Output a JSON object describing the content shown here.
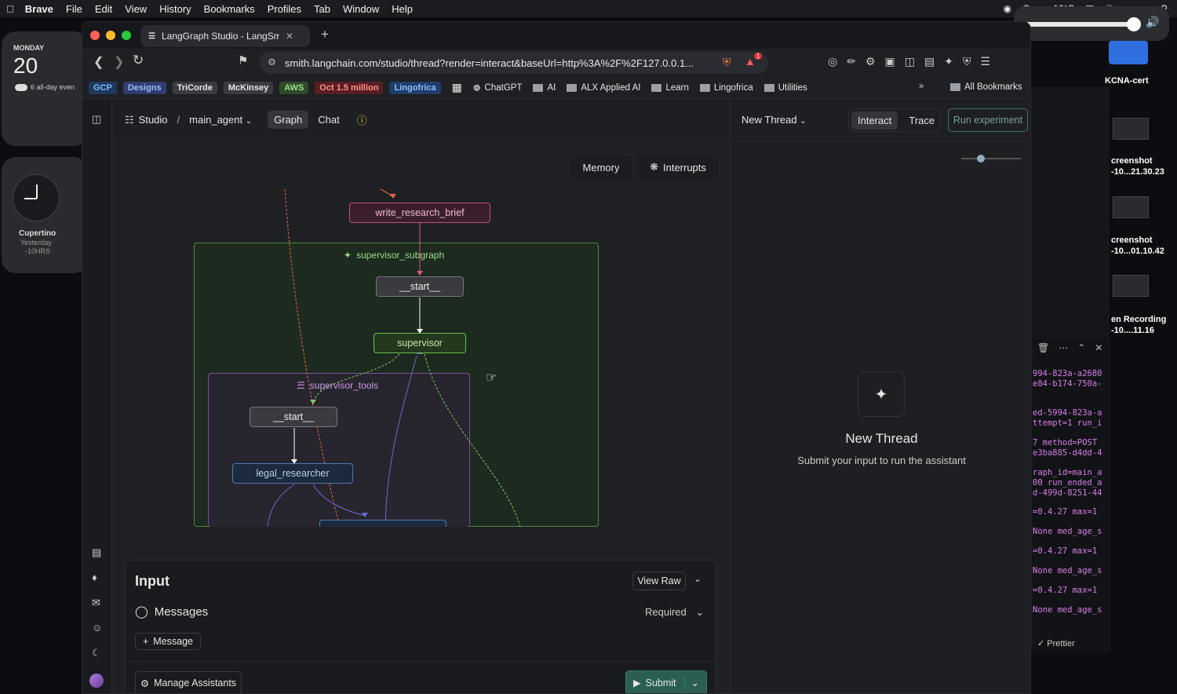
{
  "menubar": {
    "app": "Brave",
    "items": [
      "File",
      "Edit",
      "View",
      "History",
      "Bookmarks",
      "Profiles",
      "Tab",
      "Window",
      "Help"
    ],
    "temperature": "16°C"
  },
  "calendar_widget": {
    "day": "MONDAY",
    "date": "20",
    "event": "6 all-day even"
  },
  "clock_widget": {
    "city": "Cupertino",
    "when": "Yesterday",
    "offset": "-10HRS"
  },
  "browser": {
    "tab_title": "LangGraph Studio - LangSmith",
    "url": "smith.langchain.com/studio/thread?render=interact&baseUrl=http%3A%2F%2F127.0.0.1...",
    "shield_count": "1"
  },
  "bookmarks": {
    "tags": [
      {
        "label": "GCP",
        "bg": "#1d3a5c",
        "fg": "#7fb6ff"
      },
      {
        "label": "Designs",
        "bg": "#2f3e6e",
        "fg": "#9fb8ff"
      },
      {
        "label": "TriCorde",
        "bg": "#3a3b40",
        "fg": "#e8e8e8"
      },
      {
        "label": "McKinsey",
        "bg": "#3a3b40",
        "fg": "#e8e8e8"
      },
      {
        "label": "AWS",
        "bg": "#2d4a2a",
        "fg": "#9fe090"
      },
      {
        "label": "Oct 1.5 million",
        "bg": "#5a1e22",
        "fg": "#ff8f8f"
      },
      {
        "label": "Lingofrica",
        "bg": "#1f3e6a",
        "fg": "#8fbfff"
      }
    ],
    "items": [
      "ChatGPT",
      "AI",
      "ALX Applied AI",
      "Learn",
      "Lingofrica",
      "Utilities"
    ],
    "all": "All Bookmarks"
  },
  "studio": {
    "breadcrumb_root": "Studio",
    "sep": "/",
    "graph_name": "main_agent",
    "tabs": [
      "Graph",
      "Chat"
    ],
    "right_thread": "New Thread",
    "right_tabs": [
      "Interact",
      "Trace"
    ],
    "run_experiment": "Run experiment",
    "canvas_buttons": {
      "memory": "Memory",
      "interrupts": "Interrupts"
    }
  },
  "graph": {
    "nodes": {
      "write_research_brief": "write_research_brief",
      "supervisor_subgraph": "supervisor_subgraph",
      "start1": "__start__",
      "supervisor": "supervisor",
      "supervisor_tools": "supervisor_tools",
      "start2": "__start__",
      "legal_researcher": "legal_researcher"
    }
  },
  "input_panel": {
    "title": "Input",
    "view_raw": "View Raw",
    "messages": "Messages",
    "required": "Required",
    "add_message": "Message",
    "manage": "Manage Assistants",
    "submit": "Submit"
  },
  "empty_state": {
    "title": "New Thread",
    "subtitle": "Submit your input to run the assistant"
  },
  "desktop_files": [
    {
      "name": "KCNA-cert"
    },
    {
      "name": "creenshot",
      "sub": "-10...21.30.23"
    },
    {
      "name": "creenshot",
      "sub": "-10...01.10.42"
    },
    {
      "name": "en Recording",
      "sub": "-10....11.16"
    }
  ],
  "terminal_lines": [
    {
      "text": "994-823a-a2680",
      "color": "#d77ee8"
    },
    {
      "text": "e84-b174-750a-",
      "color": "#d77ee8"
    },
    {
      "text": "ed-5994-823a-a",
      "color": "#d77ee8"
    },
    {
      "text": "ttempt=1 run_i",
      "color": "#d77ee8"
    },
    {
      "text": "7 method=POST",
      "color": "#d77ee8"
    },
    {
      "text": "e3ba885-d4dd-4",
      "color": "#d77ee8"
    },
    {
      "text": "raph_id=main_a",
      "color": "#d77ee8"
    },
    {
      "text": "00 run_ended_a",
      "color": "#d77ee8"
    },
    {
      "text": "d-499d-8251-44",
      "color": "#d77ee8"
    },
    {
      "text": "=0.4.27 max=1",
      "color": "#d77ee8"
    },
    {
      "text": "None med_age_s",
      "color": "#d77ee8"
    },
    {
      "text": "=0.4.27 max=1",
      "color": "#d77ee8"
    },
    {
      "text": "None med_age_s",
      "color": "#d77ee8"
    },
    {
      "text": "=0.4.27 max=1",
      "color": "#d77ee8"
    },
    {
      "text": "None med_age_s",
      "color": "#d77ee8"
    }
  ],
  "prettier": "Prettier"
}
